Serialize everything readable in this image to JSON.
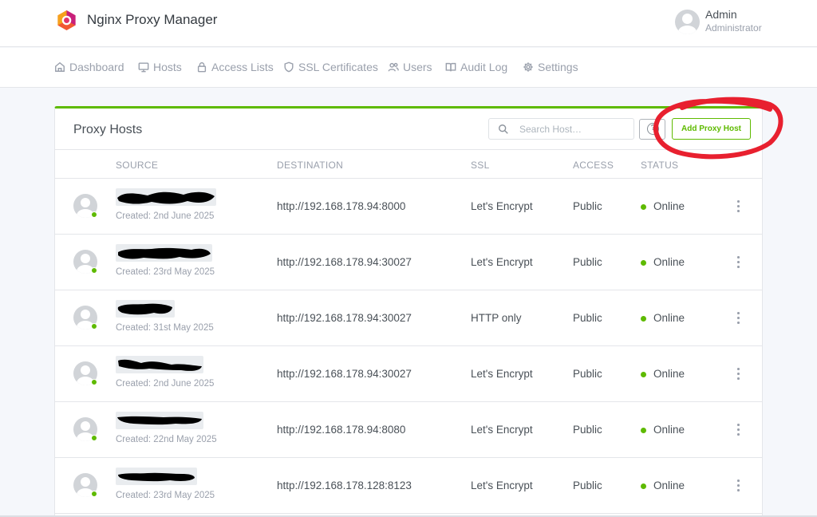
{
  "app": {
    "title": "Nginx Proxy Manager"
  },
  "user": {
    "name": "Admin",
    "role": "Administrator"
  },
  "nav": [
    {
      "label": "Dashboard",
      "icon": "home-icon"
    },
    {
      "label": "Hosts",
      "icon": "monitor-icon"
    },
    {
      "label": "Access Lists",
      "icon": "lock-icon"
    },
    {
      "label": "SSL Certificates",
      "icon": "shield-icon"
    },
    {
      "label": "Users",
      "icon": "users-icon"
    },
    {
      "label": "Audit Log",
      "icon": "book-icon"
    },
    {
      "label": "Settings",
      "icon": "gear-icon"
    }
  ],
  "card": {
    "title": "Proxy Hosts",
    "search_placeholder": "Search Host…",
    "help_label": "?",
    "add_button": "Add Proxy Host"
  },
  "columns": [
    "SOURCE",
    "DESTINATION",
    "SSL",
    "ACCESS",
    "STATUS"
  ],
  "rows": [
    {
      "created": "Created: 2nd June 2025",
      "destination": "http://192.168.178.94:8000",
      "ssl": "Let's Encrypt",
      "access": "Public",
      "status": "Online"
    },
    {
      "created": "Created: 23rd May 2025",
      "destination": "http://192.168.178.94:30027",
      "ssl": "Let's Encrypt",
      "access": "Public",
      "status": "Online"
    },
    {
      "created": "Created: 31st May 2025",
      "destination": "http://192.168.178.94:30027",
      "ssl": "HTTP only",
      "access": "Public",
      "status": "Online"
    },
    {
      "created": "Created: 2nd June 2025",
      "destination": "http://192.168.178.94:30027",
      "ssl": "Let's Encrypt",
      "access": "Public",
      "status": "Online"
    },
    {
      "created": "Created: 22nd May 2025",
      "destination": "http://192.168.178.94:8080",
      "ssl": "Let's Encrypt",
      "access": "Public",
      "status": "Online"
    },
    {
      "created": "Created: 23rd May 2025",
      "destination": "http://192.168.178.128:8123",
      "ssl": "Let's Encrypt",
      "access": "Public",
      "status": "Online"
    }
  ],
  "colors": {
    "accent": "#5eba00",
    "annotation": "#e8202f",
    "redaction": "#000000"
  }
}
